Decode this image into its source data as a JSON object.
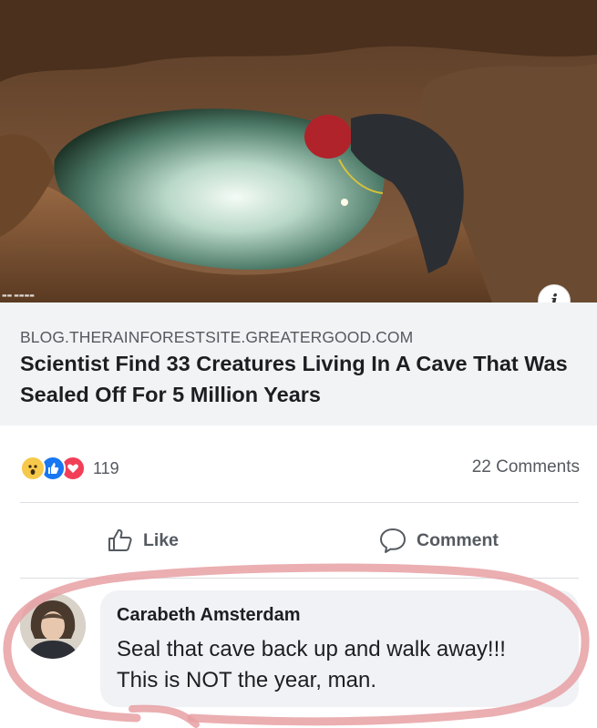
{
  "post": {
    "info_button": "i",
    "link_domain": "BLOG.THERAINFORESTSITE.GREATERGOOD.COM",
    "headline": "Scientist Find 33 Creatures Living In A Cave That Was Sealed Off For 5 Million Years"
  },
  "engagement": {
    "reactions": [
      "wow-icon",
      "like-icon",
      "love-icon"
    ],
    "reaction_count": "119",
    "comments_count": "22 Comments"
  },
  "actions": {
    "like_label": "Like",
    "comment_label": "Comment"
  },
  "comment": {
    "author": "Carabeth Amsterdam",
    "text": "Seal that cave back up and walk away!!! This is NOT the year, man."
  },
  "colors": {
    "accent_like": "#1877f2",
    "love": "#f33e58",
    "wow": "#f7c94b",
    "highlight_marker": "#e8a0a3"
  }
}
